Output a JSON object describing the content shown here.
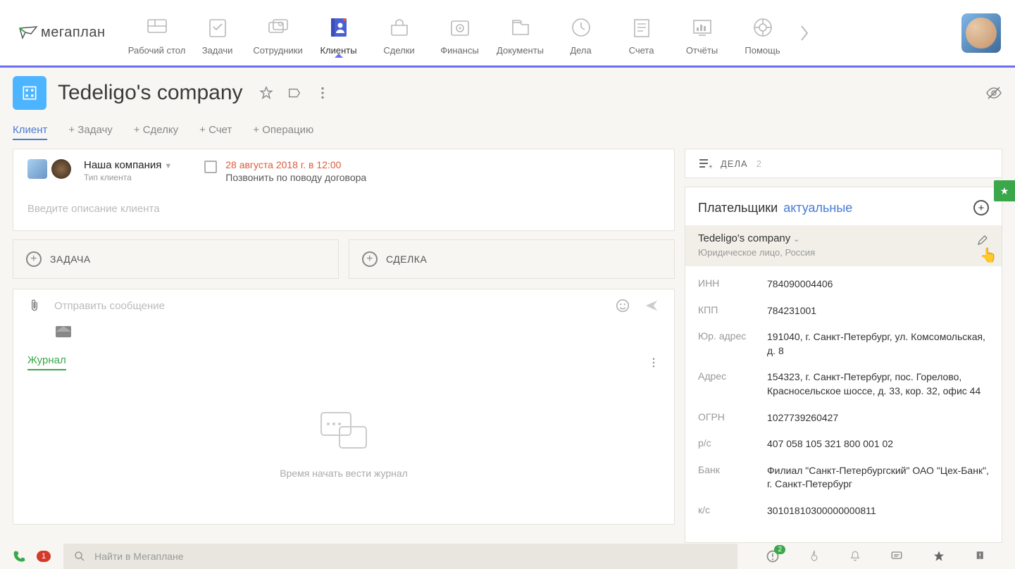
{
  "logo": "мегаплан",
  "nav": [
    {
      "label": "Рабочий стол",
      "name": "nav-desktop"
    },
    {
      "label": "Задачи",
      "name": "nav-tasks"
    },
    {
      "label": "Сотрудники",
      "name": "nav-employees"
    },
    {
      "label": "Клиенты",
      "name": "nav-clients",
      "active": true
    },
    {
      "label": "Сделки",
      "name": "nav-deals"
    },
    {
      "label": "Финансы",
      "name": "nav-finance"
    },
    {
      "label": "Документы",
      "name": "nav-docs"
    },
    {
      "label": "Дела",
      "name": "nav-activities"
    },
    {
      "label": "Счета",
      "name": "nav-invoices"
    },
    {
      "label": "Отчёты",
      "name": "nav-reports"
    },
    {
      "label": "Помощь",
      "name": "nav-help"
    }
  ],
  "pageTitle": "Tedeligo's company",
  "subnav": {
    "client": "Клиент",
    "addTask": "+ Задачу",
    "addDeal": "+ Сделку",
    "addInvoice": "+ Счет",
    "addOperation": "+ Операцию"
  },
  "clientTop": {
    "companyLabel": "Наша компания",
    "typeLabel": "Тип клиента",
    "taskDate": "28 августа 2018 г. в 12:00",
    "taskText": "Позвонить по поводу договора",
    "descPlaceholder": "Введите описание клиента"
  },
  "actions": {
    "task": "ЗАДАЧА",
    "deal": "СДЕЛКА"
  },
  "message": {
    "placeholder": "Отправить сообщение",
    "journalTab": "Журнал",
    "journalEmpty": "Время начать вести журнал"
  },
  "dela": {
    "label": "ДЕЛА",
    "count": "2"
  },
  "payers": {
    "title": "Плательщики",
    "filter": "актуальные",
    "selectedName": "Tedeligo's company",
    "selectedSub": "Юридическое лицо, Россия",
    "rows": [
      {
        "lbl": "ИНН",
        "val": "784090004406"
      },
      {
        "lbl": "КПП",
        "val": "784231001"
      },
      {
        "lbl": "Юр. адрес",
        "val": "191040, г. Санкт-Петербург, ул. Комсомольская, д. 8"
      },
      {
        "lbl": "Адрес",
        "val": "154323, г. Санкт-Петербург, пос. Горелово, Красносельское шоссе, д. 33, кор. 32, офис 44"
      },
      {
        "lbl": "ОГРН",
        "val": "1027739260427"
      },
      {
        "lbl": "р/с",
        "val": "407 058 105 321 800 001 02"
      },
      {
        "lbl": "Банк",
        "val": "Филиал \"Санкт-Петербургский\" ОАО \"Цех-Банк\", г. Санкт-Петербург"
      },
      {
        "lbl": "к/с",
        "val": "30101810300000000811"
      }
    ]
  },
  "bottom": {
    "phoneBadge": "1",
    "searchPlaceholder": "Найти в Мегаплане",
    "warnBadge": "2"
  }
}
